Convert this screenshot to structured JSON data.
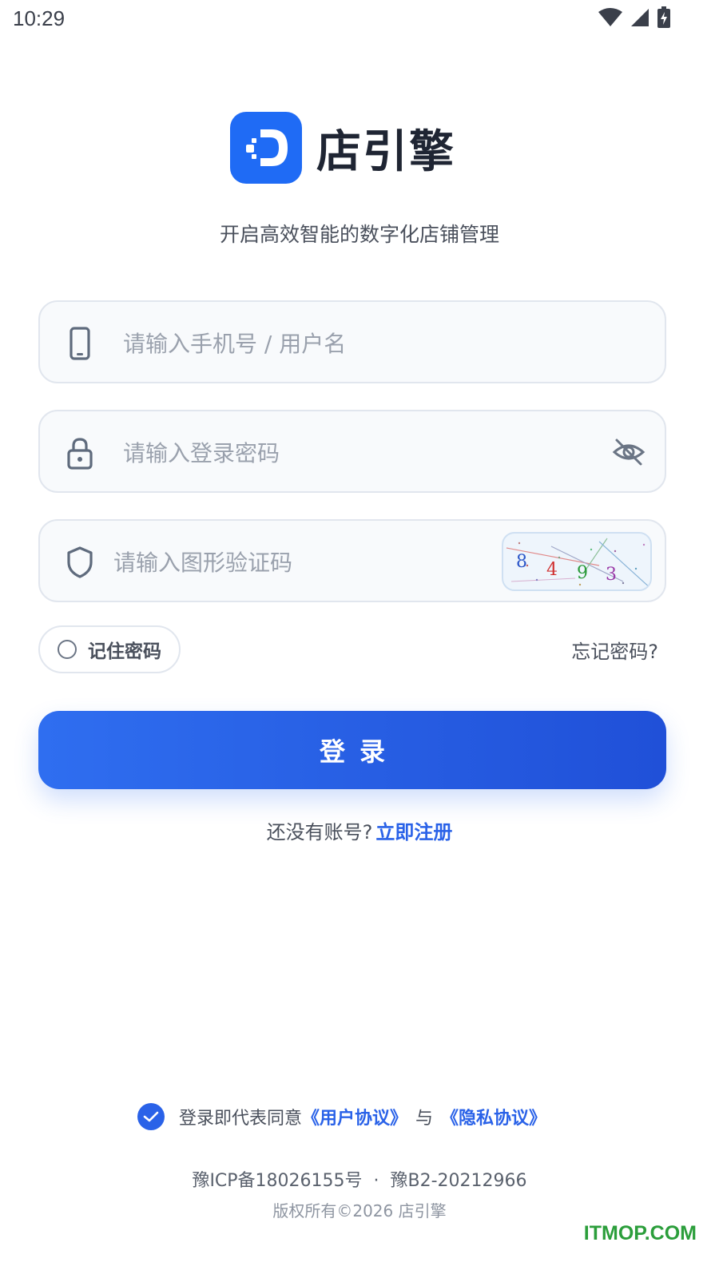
{
  "status_bar": {
    "time": "10:29"
  },
  "brand": {
    "name": "店引擎",
    "slogan": "开启高效智能的数字化店铺管理"
  },
  "login_form": {
    "username": {
      "placeholder": "请输入手机号 / 用户名",
      "value": ""
    },
    "password": {
      "placeholder": "请输入登录密码",
      "value": ""
    },
    "captcha": {
      "placeholder": "请输入图形验证码",
      "value": "",
      "code": [
        "8",
        "4",
        "9",
        "3"
      ]
    },
    "remember_label": "记住密码",
    "forgot_label": "忘记密码?",
    "login_label": "登录"
  },
  "register": {
    "prompt": "还没有账号?",
    "link": "立即注册"
  },
  "agreement": {
    "prefix": "登录即代表同意",
    "user_agreement": "《用户协议》",
    "conjunction": "与",
    "privacy_policy": "《隐私协议》"
  },
  "footer": {
    "icp": "豫ICP备18026155号",
    "separator": "·",
    "license": "豫B2-20212966",
    "copyright": "版权所有©2026 店引擎"
  },
  "watermark": "ITMOP.COM",
  "colors": {
    "accent": "#2a62e8",
    "button_start": "#2f6ef0",
    "button_end": "#2050d8",
    "text": "#1f2533",
    "muted": "#9aa1ad"
  }
}
